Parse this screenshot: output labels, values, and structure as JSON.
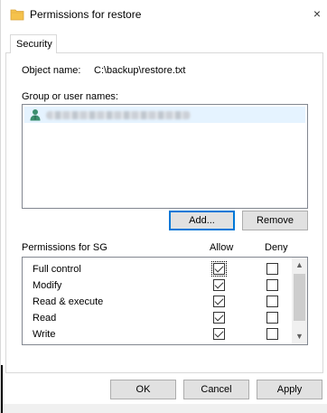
{
  "window": {
    "title": "Permissions for restore",
    "close_glyph": "×"
  },
  "tabs": [
    {
      "label": "Security"
    }
  ],
  "object": {
    "label": "Object name:",
    "value": "C:\\backup\\restore.txt"
  },
  "group": {
    "label": "Group or user names:",
    "users": [
      {
        "icon": "user-icon",
        "name_redacted": true
      }
    ]
  },
  "buttons": {
    "add": "Add...",
    "remove": "Remove",
    "ok": "OK",
    "cancel": "Cancel",
    "apply": "Apply"
  },
  "permissions": {
    "label": "Permissions for SG",
    "allow_header": "Allow",
    "deny_header": "Deny",
    "rows": [
      {
        "name": "Full control",
        "allow": true,
        "deny": false
      },
      {
        "name": "Modify",
        "allow": true,
        "deny": false
      },
      {
        "name": "Read & execute",
        "allow": true,
        "deny": false
      },
      {
        "name": "Read",
        "allow": true,
        "deny": false
      },
      {
        "name": "Write",
        "allow": true,
        "deny": false
      }
    ]
  },
  "scroll": {
    "up_glyph": "▲",
    "down_glyph": "▼"
  },
  "colors": {
    "focus": "#0078d7",
    "folder": "#f5c24c",
    "user": "#3c8f6f"
  }
}
